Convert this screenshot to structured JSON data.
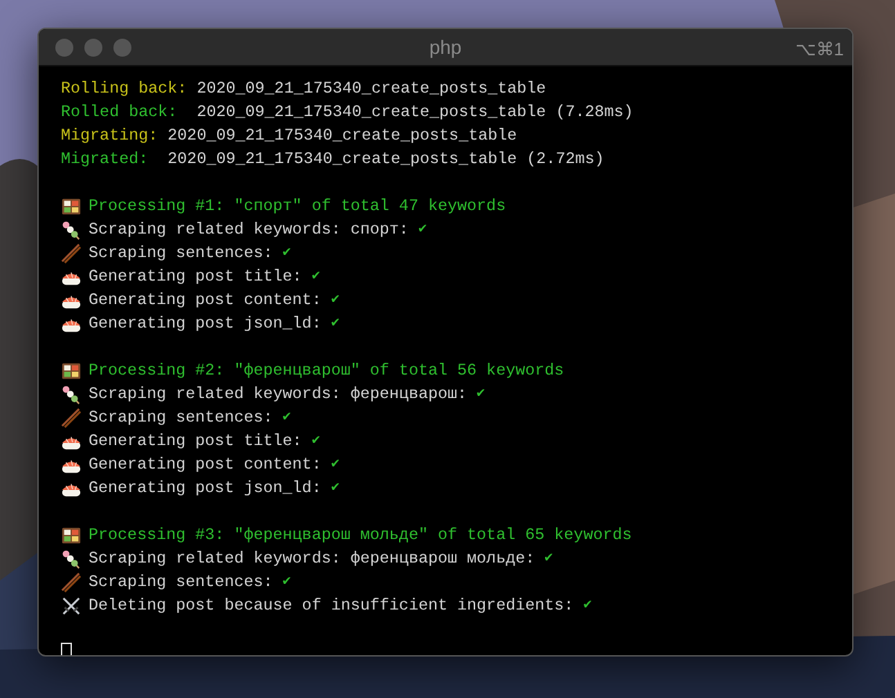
{
  "window": {
    "title": "php",
    "shortcut": "⌥⌘1"
  },
  "lines": [
    {
      "kind": "status",
      "label": "Rolling back:",
      "color": "#c8c21a",
      "text": " 2020_09_21_175340_create_posts_table"
    },
    {
      "kind": "status",
      "label": "Rolled back:",
      "color": "#2fbf2f",
      "text": "  2020_09_21_175340_create_posts_table (7.28ms)"
    },
    {
      "kind": "status",
      "label": "Migrating:",
      "color": "#c8c21a",
      "text": " 2020_09_21_175340_create_posts_table"
    },
    {
      "kind": "status",
      "label": "Migrated:",
      "color": "#2fbf2f",
      "text": "  2020_09_21_175340_create_posts_table (2.72ms)"
    },
    {
      "kind": "blank"
    },
    {
      "kind": "header",
      "text": "Processing #1: \"спорт\" of total 47 keywords"
    },
    {
      "kind": "keywords",
      "text": "Scraping related keywords: спорт:",
      "check": "✔"
    },
    {
      "kind": "sentences",
      "text": "Scraping sentences:",
      "check": "✔"
    },
    {
      "kind": "generate",
      "text": "Generating post title:",
      "check": "✔"
    },
    {
      "kind": "generate",
      "text": "Generating post content:",
      "check": "✔"
    },
    {
      "kind": "generate",
      "text": "Generating post json_ld:",
      "check": "✔"
    },
    {
      "kind": "blank"
    },
    {
      "kind": "header",
      "text": "Processing #2: \"ференцварош\" of total 56 keywords"
    },
    {
      "kind": "keywords",
      "text": "Scraping related keywords: ференцварош:",
      "check": "✔"
    },
    {
      "kind": "sentences",
      "text": "Scraping sentences:",
      "check": "✔"
    },
    {
      "kind": "generate",
      "text": "Generating post title:",
      "check": "✔"
    },
    {
      "kind": "generate",
      "text": "Generating post content:",
      "check": "✔"
    },
    {
      "kind": "generate",
      "text": "Generating post json_ld:",
      "check": "✔"
    },
    {
      "kind": "blank"
    },
    {
      "kind": "header",
      "text": "Processing #3: \"ференцварош мольде\" of total 65 keywords"
    },
    {
      "kind": "keywords",
      "text": "Scraping related keywords: ференцварош мольде:",
      "check": "✔"
    },
    {
      "kind": "sentences",
      "text": "Scraping sentences:",
      "check": "✔"
    },
    {
      "kind": "delete",
      "text": "Deleting post because of insufficient ingredients:",
      "check": "✔"
    },
    {
      "kind": "blank"
    },
    {
      "kind": "cursor"
    }
  ]
}
